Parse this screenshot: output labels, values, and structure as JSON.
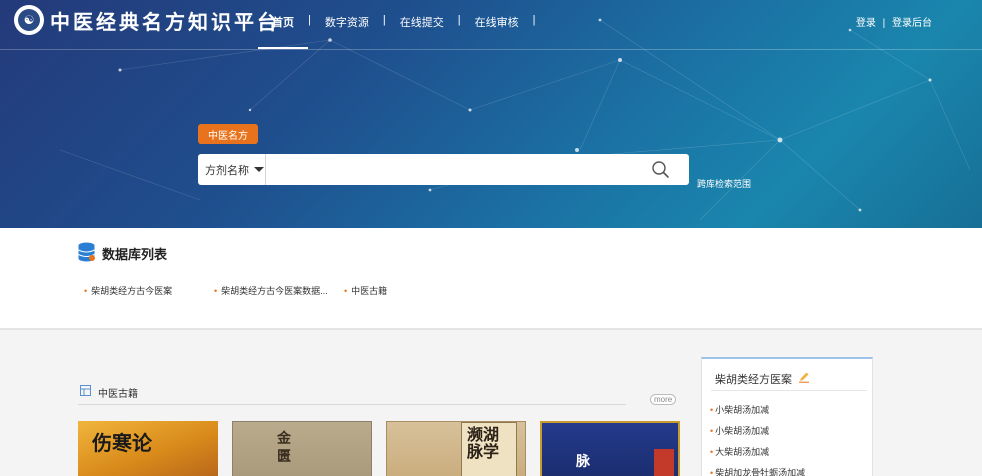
{
  "nav": {
    "logo_text": "中医经典名方知识平台",
    "links": [
      "首页",
      "数字资源",
      "在线提交",
      "在线审核"
    ],
    "separator": "|",
    "login": "登录",
    "admin": "登录后台"
  },
  "search": {
    "tag": "中医名方",
    "field_selected": "方剂名称",
    "placeholder": "",
    "cross_scope": "跨库检索范围"
  },
  "databases": {
    "title": "数据库列表",
    "items": [
      "柴胡类经方古今医案",
      "柴胡类经方古今医案数据...",
      "中医古籍"
    ]
  },
  "books_section": {
    "title": "中医古籍",
    "more": "more",
    "books": [
      {
        "cover_text": "伤寒论"
      },
      {
        "cover_text": "金匮"
      },
      {
        "cover_text": "濒湖脉学"
      },
      {
        "cover_text": "脉"
      }
    ]
  },
  "side_panel": {
    "title": "柴胡类经方医案",
    "items": [
      "小柴胡汤加减",
      "小柴胡汤加减",
      "大柴胡汤加减",
      "柴胡加龙骨牡蛎汤加减"
    ]
  },
  "colors": {
    "accent_orange": "#e9731c",
    "hero_blue": "#1f4f8e",
    "side_border": "#9cc3e6"
  }
}
